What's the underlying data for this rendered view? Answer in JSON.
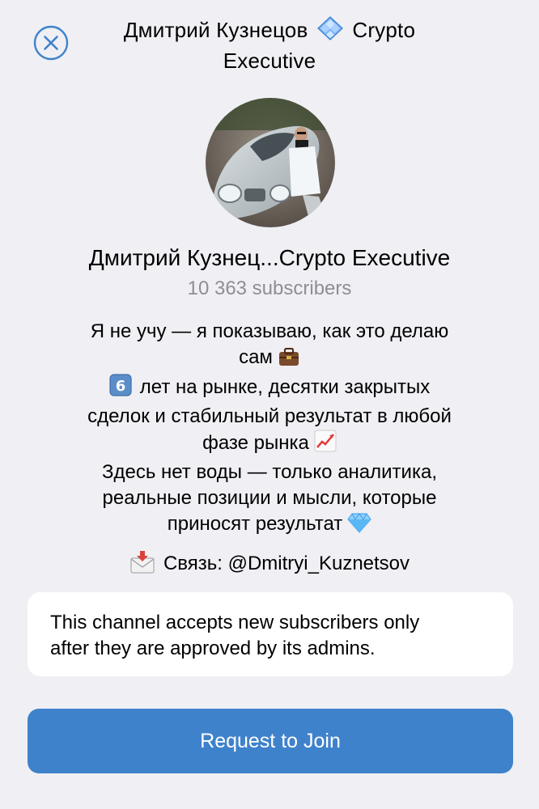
{
  "header": {
    "title_line1_prefix": "Дмитрий Кузнецов",
    "title_line1_suffix": "Crypto",
    "title_line2": "Executive",
    "close_icon": "close-circle-icon",
    "title_emoji": "blue-diamond-tiles-icon"
  },
  "channel": {
    "name": "Дмитрий Кузнец...Crypto Executive",
    "subscribers": "10 363 subscribers",
    "avatar_icon": "channel-avatar"
  },
  "description": {
    "line1": "Я не учу — я показываю, как это делаю",
    "line2": "сам",
    "line2_emoji": "briefcase-icon",
    "line3_emoji": "keycap-6-icon",
    "line3": "лет на рынке, десятки закрытых",
    "line4": "сделок и стабильный результат в любой",
    "line5": "фазе рынка",
    "line5_emoji": "chart-increasing-icon",
    "line6": "Здесь нет воды — только аналитика,",
    "line7": "реальные позиции и мысли, которые",
    "line8": "приносят результат",
    "line8_emoji": "gem-stone-icon"
  },
  "contact": {
    "emoji": "envelope-arrow-icon",
    "text": "Связь: @Dmitryi_Kuznetsov"
  },
  "notice": {
    "line1": "This channel accepts new subscribers only",
    "line2": "after they are approved by its admins."
  },
  "actions": {
    "join_label": "Request to Join"
  },
  "colors": {
    "accent": "#3f82cc",
    "background": "#efeff4",
    "secondary_text": "#8e8e93"
  }
}
